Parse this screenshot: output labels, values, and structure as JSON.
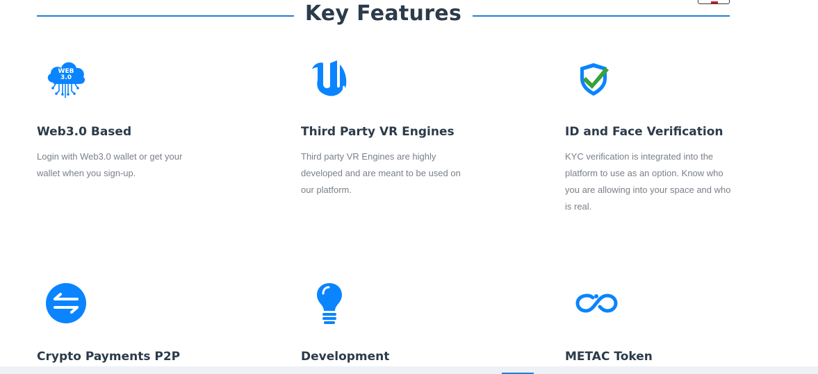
{
  "section": {
    "title": "Key Features"
  },
  "features": [
    {
      "icon": "web3-cloud-icon",
      "icon_text_top": "WEB",
      "icon_text_bottom": "3.0",
      "title": "Web3.0 Based",
      "description": "Login with Web3.0 wallet or get your wallet when you sign-up."
    },
    {
      "icon": "unreal-engine-icon",
      "title": "Third Party VR Engines",
      "description": "Third party VR Engines are highly developed and are meant to be used on our platform."
    },
    {
      "icon": "shield-check-icon",
      "title": "ID and Face Verification",
      "description": "KYC verification is integrated into the platform to use as an option. Know who you are allowing into your space and who is real."
    },
    {
      "icon": "exchange-arrows-icon",
      "title": "Crypto Payments P2P",
      "description": ""
    },
    {
      "icon": "lightbulb-icon",
      "title": "Development",
      "description": ""
    },
    {
      "icon": "infinity-token-icon",
      "title": "METAC Token",
      "description": ""
    }
  ],
  "colors": {
    "accent": "#1f7fd6",
    "icon_blue": "#0a84ff",
    "check_green": "#3aa13a",
    "heading": "#2c3b4a",
    "body_text": "#7a8088"
  }
}
